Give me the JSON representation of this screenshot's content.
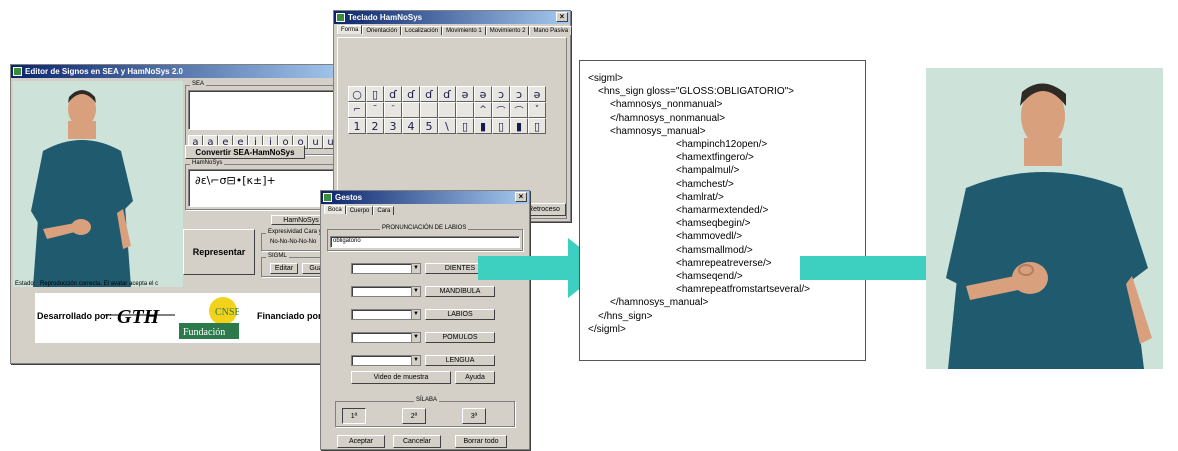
{
  "editor": {
    "title": "Editor de Signos en SEA y HamNoSys 2.0",
    "sea_label": "SEA",
    "sea_keys": [
      "a",
      "a",
      "e",
      "e",
      "i",
      "i",
      "o",
      "o",
      "u",
      "u"
    ],
    "convert_button": "Convertir SEA-HamNoSys",
    "hamnosys_label": "HamNoSys",
    "hamnosys_value": "∂ε\\⌐σ⊟•[κ±]+",
    "hamnosys_button": "HamNoSys",
    "represent_button": "Representar",
    "expressivity_label": "Expresividad Cara y C",
    "expressivity_value": "No-No-No-No-No",
    "sigml_label": "SIGML",
    "edit_button": "Editar",
    "save_button": "Gua",
    "status_label": "Estado:",
    "status_text": "Reproducción correcta. El avatar acepta el c",
    "developed_by": "Desarrollado por:",
    "gth_logo": "GTH",
    "cnse_logo": "CNSE",
    "fundacion_logo": "Fundación",
    "funded_by": "Financiado por:"
  },
  "keyboard": {
    "title": "Teclado HamNoSys",
    "tabs": [
      "Forma",
      "Orientación",
      "Localización",
      "Movimiento 1",
      "Movimiento 2",
      "Mano Pasiva"
    ],
    "row1": [
      "○",
      "▯",
      "ɗ",
      "ɗ",
      "ɗ",
      "ɗ",
      "ə",
      "ə",
      "ɔ",
      "ɔ",
      "ə"
    ],
    "row2": [
      "⌐",
      "˜",
      "ˉ",
      "",
      "",
      "",
      "",
      "^",
      "⌒",
      "⌒",
      "˅"
    ],
    "row3": [
      "1",
      "2",
      "3",
      "4",
      "5",
      "\\",
      "▯",
      "▮",
      "▯",
      "▮",
      "▯"
    ],
    "retroceso_button": "Retroceso"
  },
  "gestures": {
    "title": "Gestos",
    "tabs": [
      "Boca",
      "Cuerpo",
      "Cara"
    ],
    "lip_group": "PRONUNCIACIÓN DE LABIOS",
    "lip_value": "obligatorio",
    "dropdowns": [
      "DIENTES",
      "MANDÍBULA",
      "LABIOS",
      "PÓMULOS",
      "LENGUA"
    ],
    "video_button": "Video de muestra",
    "help_button": "Ayuda",
    "syllable_group": "SÍLABA",
    "syllables": [
      "1ª",
      "2ª",
      "3ª"
    ],
    "accept_button": "Aceptar",
    "cancel_button": "Cancelar",
    "clear_button": "Borrar todo"
  },
  "xml": {
    "lines": [
      "<sigml>",
      "<hns_sign gloss=\"GLOSS:OBLIGATORIO\">",
      "<hamnosys_nonmanual>",
      "</hamnosys_nonmanual>",
      "<hamnosys_manual>",
      "<hampinch12open/>",
      "<hamextfingero/>",
      "<hampalmul/>",
      "<hamchest/>",
      "<hamlrat/>",
      "<hamarmextended/>",
      "<hamseqbegin/>",
      "<hammovedl/>",
      "<hamsmallmod/>",
      "<hamrepeatreverse/>",
      "<hamseqend/>",
      "<hamrepeatfromstartseveral/>",
      "</hamnosys_manual>",
      "</hns_sign>",
      "</sigml>"
    ]
  },
  "colors": {
    "arrow": "#3dcfc0",
    "avatar_bg": "#cde3da",
    "shirt": "#1f5a6e",
    "skin": "#d9a07e",
    "hair": "#2e2a26",
    "titlebar": "#0a246a",
    "cnse_yellow": "#f2d21a",
    "fundacion_green": "#2c7a4b"
  }
}
